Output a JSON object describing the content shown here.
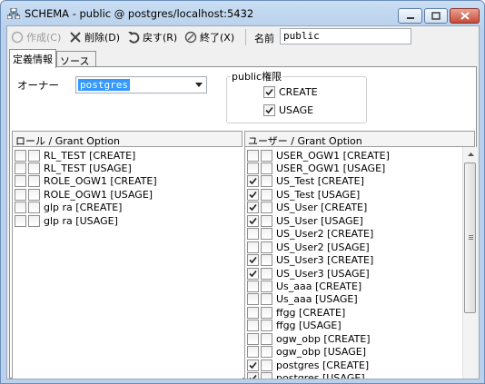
{
  "window": {
    "title": "SCHEMA - public @ postgres/localhost:5432"
  },
  "toolbar": {
    "create_label": "作成(C)",
    "delete_label": "削除(D)",
    "back_label": "戻す(R)",
    "exit_label": "終了(X)",
    "name_label": "名前",
    "name_value": "public"
  },
  "tabs": [
    {
      "label": "定義情報",
      "active": true
    },
    {
      "label": "ソース",
      "active": false
    }
  ],
  "owner": {
    "label": "オーナー",
    "value": "postgres"
  },
  "public_privileges": {
    "title": "public権限",
    "items": [
      {
        "label": "CREATE",
        "checked": true
      },
      {
        "label": "USAGE",
        "checked": true
      }
    ]
  },
  "roles": {
    "header": "ロール / Grant Option",
    "items": [
      {
        "label": "RL_TEST [CREATE]",
        "checked": false,
        "grant": false
      },
      {
        "label": "RL_TEST [USAGE]",
        "checked": false,
        "grant": false
      },
      {
        "label": "ROLE_OGW1 [CREATE]",
        "checked": false,
        "grant": false
      },
      {
        "label": "ROLE_OGW1 [USAGE]",
        "checked": false,
        "grant": false
      },
      {
        "label": "glp ra [CREATE]",
        "checked": false,
        "grant": false
      },
      {
        "label": "glp ra [USAGE]",
        "checked": false,
        "grant": false
      }
    ]
  },
  "users": {
    "header": "ユーザー / Grant Option",
    "items": [
      {
        "label": "USER_OGW1 [CREATE]",
        "checked": false,
        "grant": false
      },
      {
        "label": "USER_OGW1 [USAGE]",
        "checked": false,
        "grant": false
      },
      {
        "label": "US_Test [CREATE]",
        "checked": true,
        "grant": false
      },
      {
        "label": "US_Test [USAGE]",
        "checked": true,
        "grant": false
      },
      {
        "label": "US_User [CREATE]",
        "checked": true,
        "grant": false
      },
      {
        "label": "US_User [USAGE]",
        "checked": true,
        "grant": false
      },
      {
        "label": "US_User2 [CREATE]",
        "checked": false,
        "grant": false
      },
      {
        "label": "US_User2 [USAGE]",
        "checked": false,
        "grant": false
      },
      {
        "label": "US_User3 [CREATE]",
        "checked": true,
        "grant": false
      },
      {
        "label": "US_User3 [USAGE]",
        "checked": true,
        "grant": false
      },
      {
        "label": "Us_aaa [CREATE]",
        "checked": false,
        "grant": false
      },
      {
        "label": "Us_aaa [USAGE]",
        "checked": false,
        "grant": false
      },
      {
        "label": "ffgg [CREATE]",
        "checked": false,
        "grant": false
      },
      {
        "label": "ffgg [USAGE]",
        "checked": false,
        "grant": false
      },
      {
        "label": "ogw_obp [CREATE]",
        "checked": false,
        "grant": false
      },
      {
        "label": "ogw_obp [USAGE]",
        "checked": false,
        "grant": false
      },
      {
        "label": "postgres [CREATE]",
        "checked": true,
        "grant": false
      },
      {
        "label": "postgres [USAGE]",
        "checked": true,
        "grant": false
      }
    ]
  },
  "colors": {
    "selection": "#3399ff",
    "titlebar": "#c9ddf3",
    "close_button": "#c74a37"
  }
}
